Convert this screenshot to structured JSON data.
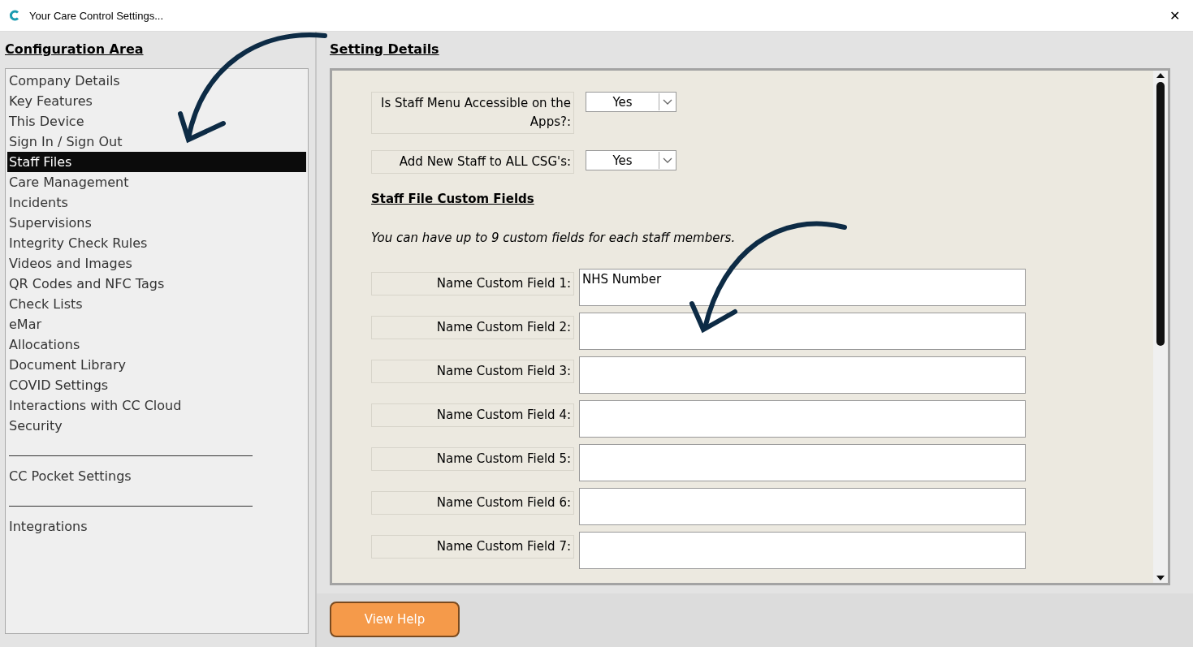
{
  "window": {
    "title": "Your Care Control Settings...",
    "close": "✕"
  },
  "configuration": {
    "heading": "Configuration Area",
    "items": [
      {
        "kind": "item",
        "label": "Company Details",
        "selected": false
      },
      {
        "kind": "item",
        "label": "Key Features",
        "selected": false
      },
      {
        "kind": "item",
        "label": "This Device",
        "selected": false
      },
      {
        "kind": "item",
        "label": "Sign In / Sign Out",
        "selected": false
      },
      {
        "kind": "item",
        "label": "Staff Files",
        "selected": true
      },
      {
        "kind": "item",
        "label": "Care Management",
        "selected": false
      },
      {
        "kind": "item",
        "label": "Incidents",
        "selected": false
      },
      {
        "kind": "item",
        "label": "Supervisions",
        "selected": false
      },
      {
        "kind": "item",
        "label": "Integrity Check Rules",
        "selected": false
      },
      {
        "kind": "item",
        "label": "Videos and Images",
        "selected": false
      },
      {
        "kind": "item",
        "label": "QR Codes and NFC Tags",
        "selected": false
      },
      {
        "kind": "item",
        "label": "Check Lists",
        "selected": false
      },
      {
        "kind": "item",
        "label": "eMar",
        "selected": false
      },
      {
        "kind": "item",
        "label": "Allocations",
        "selected": false
      },
      {
        "kind": "item",
        "label": "Document Library",
        "selected": false
      },
      {
        "kind": "item",
        "label": "COVID Settings",
        "selected": false
      },
      {
        "kind": "item",
        "label": "Interactions with CC Cloud",
        "selected": false
      },
      {
        "kind": "item",
        "label": "Security",
        "selected": false
      },
      {
        "kind": "divider"
      },
      {
        "kind": "item",
        "label": "CC Pocket Settings",
        "selected": false
      },
      {
        "kind": "divider"
      },
      {
        "kind": "item",
        "label": "Integrations",
        "selected": false
      }
    ]
  },
  "settings": {
    "heading": "Setting Details",
    "dropdowns": [
      {
        "label": "Is Staff Menu Accessible on the Apps?:",
        "value": "Yes"
      },
      {
        "label": "Add New Staff to ALL CSG's:",
        "value": "Yes"
      }
    ],
    "section_title": "Staff File Custom Fields",
    "note": "You can have up to 9 custom fields for each staff members.",
    "custom_fields": [
      {
        "label": "Name Custom Field 1:",
        "value": "NHS Number"
      },
      {
        "label": "Name Custom Field 2:"
      },
      {
        "label": "Name Custom Field 3:"
      },
      {
        "label": "Name Custom Field 4:"
      },
      {
        "label": "Name Custom Field 5:"
      },
      {
        "label": "Name Custom Field 6:"
      },
      {
        "label": "Name Custom Field 7:"
      }
    ]
  },
  "footer": {
    "help_button": "View Help"
  }
}
